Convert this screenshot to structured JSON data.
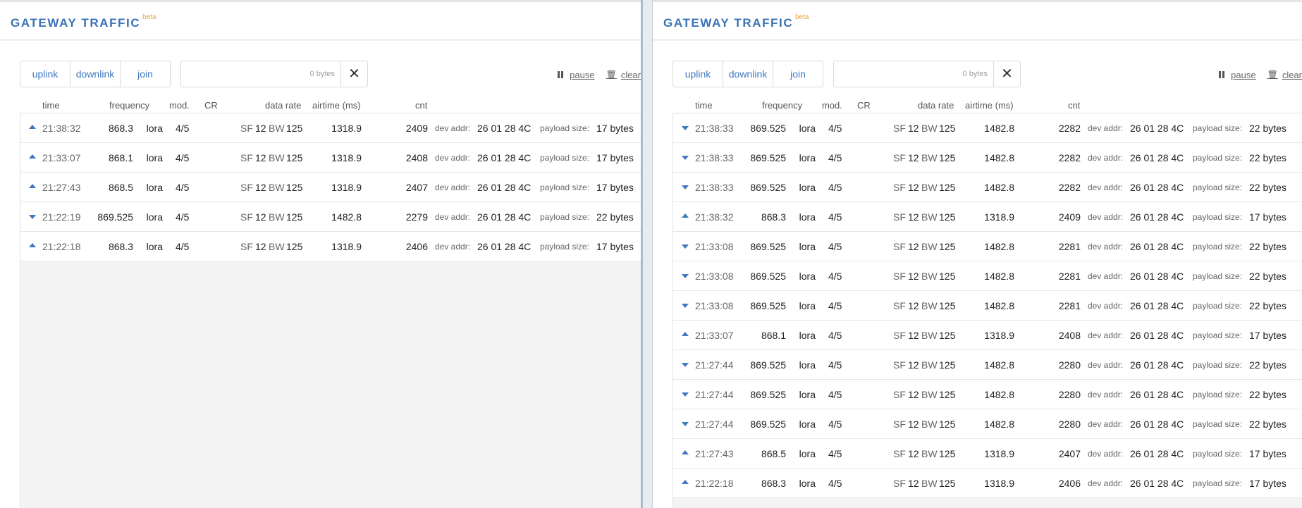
{
  "title": "GATEWAY TRAFFIC",
  "beta": "beta",
  "filters": [
    "uplink",
    "downlink",
    "join"
  ],
  "search": {
    "placeholder": "0 bytes",
    "clear": "✕"
  },
  "actions": {
    "pause": "pause",
    "clear": "clear"
  },
  "columns": {
    "time": "time",
    "frequency": "frequency",
    "mod": "mod.",
    "cr": "CR",
    "datarate": "data rate",
    "airtime": "airtime (ms)",
    "cnt": "cnt"
  },
  "labels": {
    "sf": "SF",
    "bw": "BW",
    "devaddr": "dev addr:",
    "payload": "payload size:"
  },
  "left_rows": [
    {
      "dir": "up",
      "time": "21:38:32",
      "freq": "868.3",
      "mod": "lora",
      "cr": "4/5",
      "sf": "12",
      "bw": "125",
      "air": "1318.9",
      "cnt": "2409",
      "devaddr": "26 01 28 4C",
      "payload": "17 bytes"
    },
    {
      "dir": "up",
      "time": "21:33:07",
      "freq": "868.1",
      "mod": "lora",
      "cr": "4/5",
      "sf": "12",
      "bw": "125",
      "air": "1318.9",
      "cnt": "2408",
      "devaddr": "26 01 28 4C",
      "payload": "17 bytes"
    },
    {
      "dir": "up",
      "time": "21:27:43",
      "freq": "868.5",
      "mod": "lora",
      "cr": "4/5",
      "sf": "12",
      "bw": "125",
      "air": "1318.9",
      "cnt": "2407",
      "devaddr": "26 01 28 4C",
      "payload": "17 bytes"
    },
    {
      "dir": "down",
      "time": "21:22:19",
      "freq": "869.525",
      "mod": "lora",
      "cr": "4/5",
      "sf": "12",
      "bw": "125",
      "air": "1482.8",
      "cnt": "2279",
      "devaddr": "26 01 28 4C",
      "payload": "22 bytes"
    },
    {
      "dir": "up",
      "time": "21:22:18",
      "freq": "868.3",
      "mod": "lora",
      "cr": "4/5",
      "sf": "12",
      "bw": "125",
      "air": "1318.9",
      "cnt": "2406",
      "devaddr": "26 01 28 4C",
      "payload": "17 bytes"
    }
  ],
  "right_rows": [
    {
      "dir": "down",
      "time": "21:38:33",
      "freq": "869.525",
      "mod": "lora",
      "cr": "4/5",
      "sf": "12",
      "bw": "125",
      "air": "1482.8",
      "cnt": "2282",
      "devaddr": "26 01 28 4C",
      "payload": "22 bytes"
    },
    {
      "dir": "down",
      "time": "21:38:33",
      "freq": "869.525",
      "mod": "lora",
      "cr": "4/5",
      "sf": "12",
      "bw": "125",
      "air": "1482.8",
      "cnt": "2282",
      "devaddr": "26 01 28 4C",
      "payload": "22 bytes"
    },
    {
      "dir": "down",
      "time": "21:38:33",
      "freq": "869.525",
      "mod": "lora",
      "cr": "4/5",
      "sf": "12",
      "bw": "125",
      "air": "1482.8",
      "cnt": "2282",
      "devaddr": "26 01 28 4C",
      "payload": "22 bytes"
    },
    {
      "dir": "up",
      "time": "21:38:32",
      "freq": "868.3",
      "mod": "lora",
      "cr": "4/5",
      "sf": "12",
      "bw": "125",
      "air": "1318.9",
      "cnt": "2409",
      "devaddr": "26 01 28 4C",
      "payload": "17 bytes"
    },
    {
      "dir": "down",
      "time": "21:33:08",
      "freq": "869.525",
      "mod": "lora",
      "cr": "4/5",
      "sf": "12",
      "bw": "125",
      "air": "1482.8",
      "cnt": "2281",
      "devaddr": "26 01 28 4C",
      "payload": "22 bytes"
    },
    {
      "dir": "down",
      "time": "21:33:08",
      "freq": "869.525",
      "mod": "lora",
      "cr": "4/5",
      "sf": "12",
      "bw": "125",
      "air": "1482.8",
      "cnt": "2281",
      "devaddr": "26 01 28 4C",
      "payload": "22 bytes"
    },
    {
      "dir": "down",
      "time": "21:33:08",
      "freq": "869.525",
      "mod": "lora",
      "cr": "4/5",
      "sf": "12",
      "bw": "125",
      "air": "1482.8",
      "cnt": "2281",
      "devaddr": "26 01 28 4C",
      "payload": "22 bytes"
    },
    {
      "dir": "up",
      "time": "21:33:07",
      "freq": "868.1",
      "mod": "lora",
      "cr": "4/5",
      "sf": "12",
      "bw": "125",
      "air": "1318.9",
      "cnt": "2408",
      "devaddr": "26 01 28 4C",
      "payload": "17 bytes"
    },
    {
      "dir": "down",
      "time": "21:27:44",
      "freq": "869.525",
      "mod": "lora",
      "cr": "4/5",
      "sf": "12",
      "bw": "125",
      "air": "1482.8",
      "cnt": "2280",
      "devaddr": "26 01 28 4C",
      "payload": "22 bytes"
    },
    {
      "dir": "down",
      "time": "21:27:44",
      "freq": "869.525",
      "mod": "lora",
      "cr": "4/5",
      "sf": "12",
      "bw": "125",
      "air": "1482.8",
      "cnt": "2280",
      "devaddr": "26 01 28 4C",
      "payload": "22 bytes"
    },
    {
      "dir": "down",
      "time": "21:27:44",
      "freq": "869.525",
      "mod": "lora",
      "cr": "4/5",
      "sf": "12",
      "bw": "125",
      "air": "1482.8",
      "cnt": "2280",
      "devaddr": "26 01 28 4C",
      "payload": "22 bytes"
    },
    {
      "dir": "up",
      "time": "21:27:43",
      "freq": "868.5",
      "mod": "lora",
      "cr": "4/5",
      "sf": "12",
      "bw": "125",
      "air": "1318.9",
      "cnt": "2407",
      "devaddr": "26 01 28 4C",
      "payload": "17 bytes"
    },
    {
      "dir": "up",
      "time": "21:22:18",
      "freq": "868.3",
      "mod": "lora",
      "cr": "4/5",
      "sf": "12",
      "bw": "125",
      "air": "1318.9",
      "cnt": "2406",
      "devaddr": "26 01 28 4C",
      "payload": "17 bytes"
    }
  ]
}
